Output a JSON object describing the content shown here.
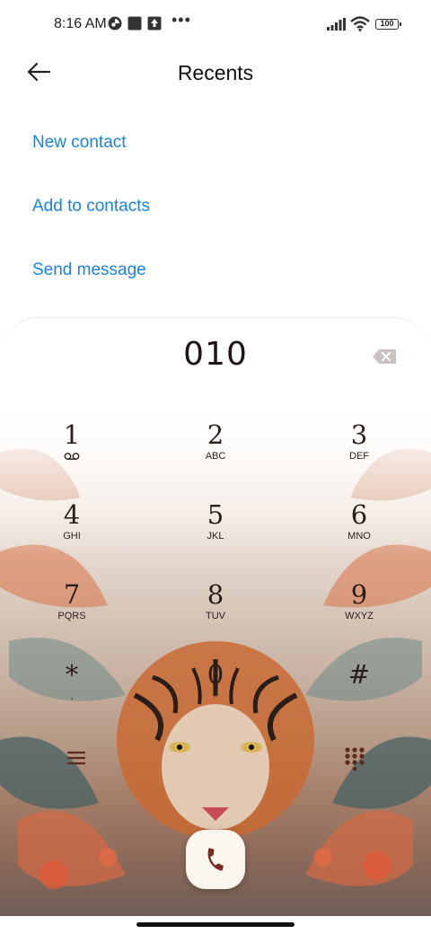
{
  "status_bar": {
    "time": "8:16 AM",
    "icons": [
      "app-notification-icon",
      "square-notification-icon",
      "upload-notification-icon",
      "more-dots-icon",
      "signal-icon",
      "wifi-icon",
      "battery-icon"
    ],
    "overflow": "•••",
    "battery_level": "100"
  },
  "header": {
    "title": "Recents",
    "back_icon": "arrow-left-icon"
  },
  "actions": {
    "new_contact": "New contact",
    "add_to_contacts": "Add to contacts",
    "send_message": "Send message"
  },
  "dialpad": {
    "number": "010",
    "backspace_icon": "backspace-icon",
    "keys": [
      {
        "digit": "1",
        "letters": "",
        "sub_icon": "voicemail-icon"
      },
      {
        "digit": "2",
        "letters": "ABC"
      },
      {
        "digit": "3",
        "letters": "DEF"
      },
      {
        "digit": "4",
        "letters": "GHI"
      },
      {
        "digit": "5",
        "letters": "JKL"
      },
      {
        "digit": "6",
        "letters": "MNO"
      },
      {
        "digit": "7",
        "letters": "PQRS"
      },
      {
        "digit": "8",
        "letters": "TUV"
      },
      {
        "digit": "9",
        "letters": "WXYZ"
      },
      {
        "digit": "*",
        "letters": ","
      },
      {
        "digit": "0",
        "letters": "+"
      },
      {
        "digit": "#",
        "letters": ""
      }
    ],
    "menu_icon": "menu-icon",
    "dialpad_toggle_icon": "dialpad-icon",
    "call_icon": "phone-icon",
    "wallpaper": "tiger-wallpaper"
  },
  "colors": {
    "accent": "#1a82e2",
    "key_text": "#2a1e1a",
    "call_button_bg": "#fbf5ef",
    "call_icon": "#7a2a22"
  }
}
